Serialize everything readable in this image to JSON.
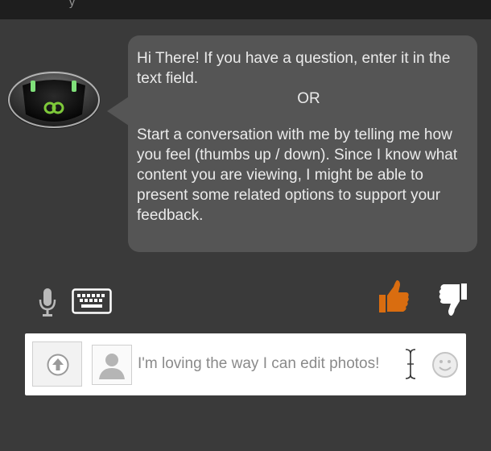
{
  "header": {
    "partial_text": "y"
  },
  "bot": {
    "message_intro": "Hi There!  If you have a question, enter it in the text field.",
    "message_or": "OR",
    "message_body": "Start a conversation with me by telling me how you feel (thumbs up / down).  Since I know what content you are viewing, I might be able to present some related options to support your feedback."
  },
  "toolbar": {
    "mic_icon": "microphone-icon",
    "keyboard_icon": "keyboard-icon",
    "thumbs_up_icon": "thumbs-up-icon",
    "thumbs_down_icon": "thumbs-down-icon",
    "thumbs_up_color": "#d96d10",
    "thumbs_down_color": "#ffffff"
  },
  "composer": {
    "upload_icon": "upload-arrow-icon",
    "avatar_icon": "user-silhouette-icon",
    "input_value": "I'm loving the way I can edit photos!",
    "emoji_icon": "smiley-icon"
  }
}
